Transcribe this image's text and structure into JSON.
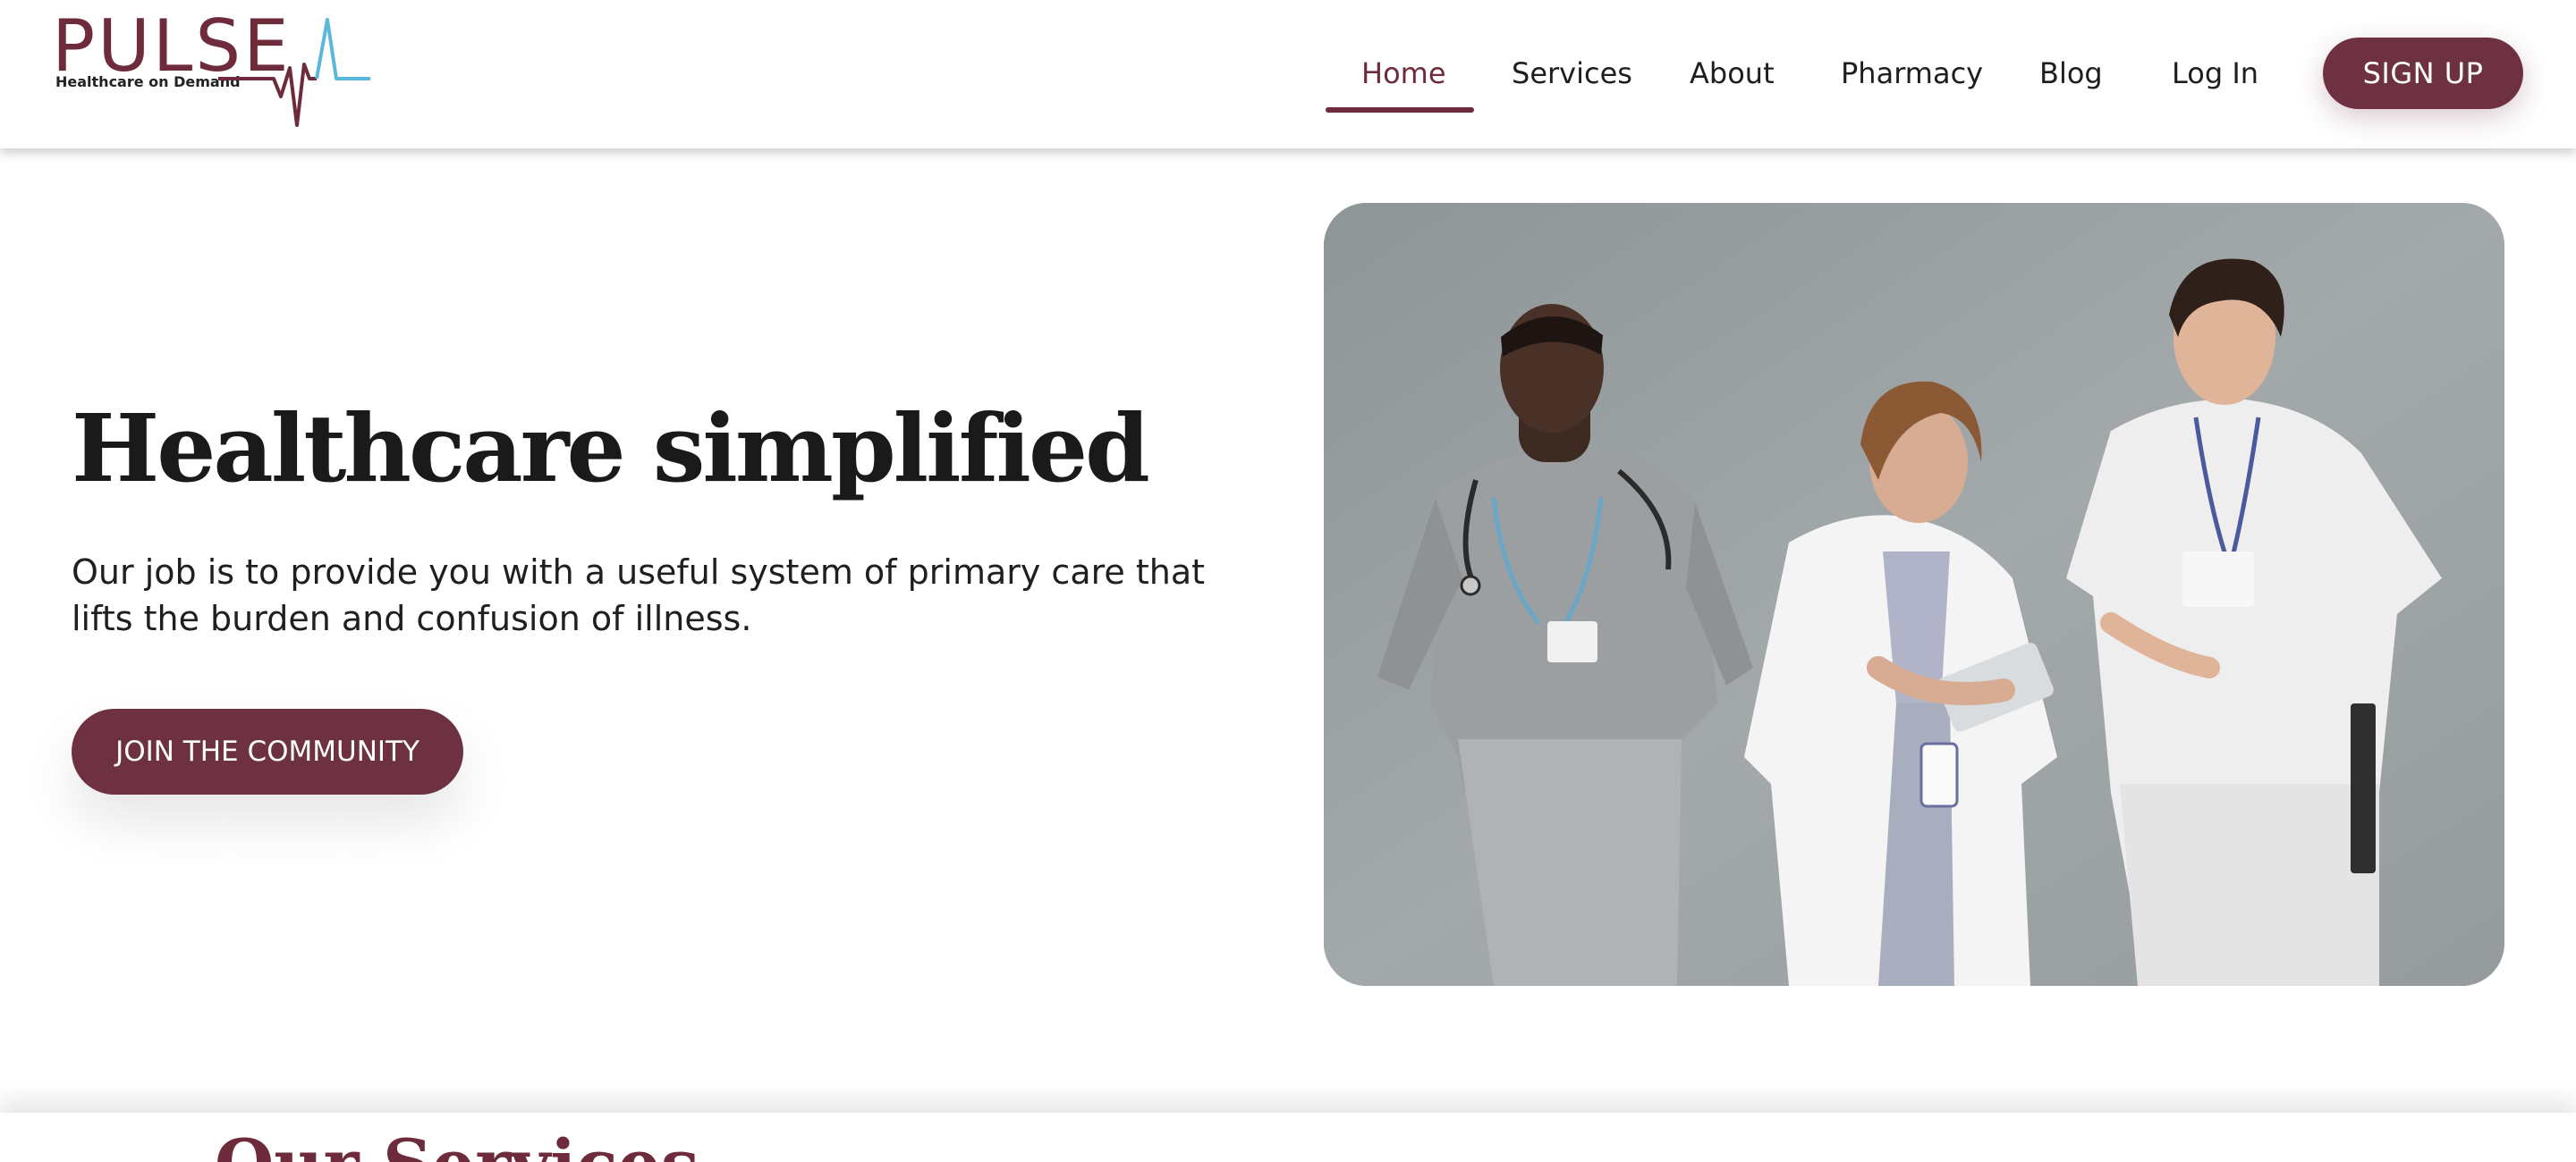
{
  "brand": {
    "name": "PULSE",
    "tagline": "Healthcare on Demand",
    "primary_color": "#6e2b3b",
    "pulse_line_color": "#5bb8dd"
  },
  "nav": {
    "items": [
      {
        "label": "Home",
        "active": true
      },
      {
        "label": "Services",
        "active": false
      },
      {
        "label": "About",
        "active": false
      },
      {
        "label": "Pharmacy",
        "active": false
      },
      {
        "label": "Blog",
        "active": false
      },
      {
        "label": "Log In",
        "active": false
      }
    ],
    "signup_label": "SIGN UP"
  },
  "hero": {
    "title": "Healthcare simplified",
    "description": "Our job is to provide you with a useful system of primary care that lifts the burden and confusion of illness.",
    "cta_label": "JOIN THE COMMUNITY",
    "image": "three medical professionals in scrubs and a white coat smiling"
  },
  "services": {
    "title": "Our Services"
  }
}
